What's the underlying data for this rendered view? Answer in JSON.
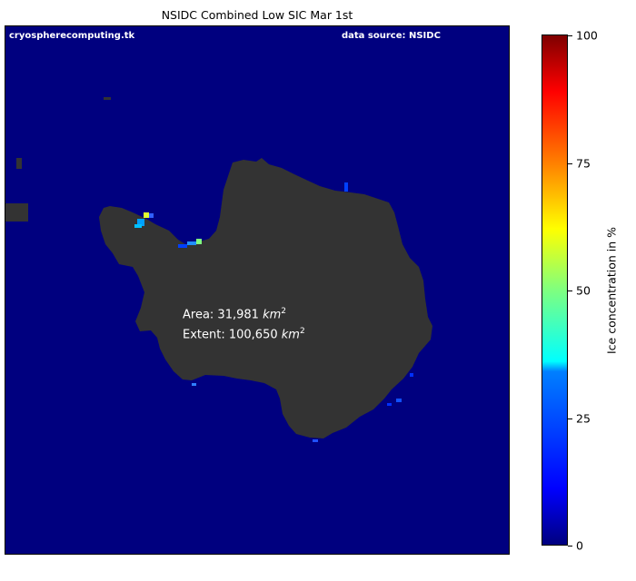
{
  "title": "NSIDC Combined Low SIC Mar 1st",
  "watermark_left": "cryospherecomputing.tk",
  "watermark_right": "data source: NSIDC",
  "stats": {
    "area_label": "Area: 31,981 ",
    "extent_label": "Extent: 100,650 ",
    "unit": "km",
    "unit_power": "2"
  },
  "colorbar": {
    "label": "Ice concentration in %",
    "ticks": [
      "0",
      "25",
      "50",
      "75",
      "100"
    ],
    "colormap": "jet",
    "range": [
      0,
      100
    ]
  },
  "colors": {
    "ocean": "#00007f",
    "land": "#333333"
  }
}
